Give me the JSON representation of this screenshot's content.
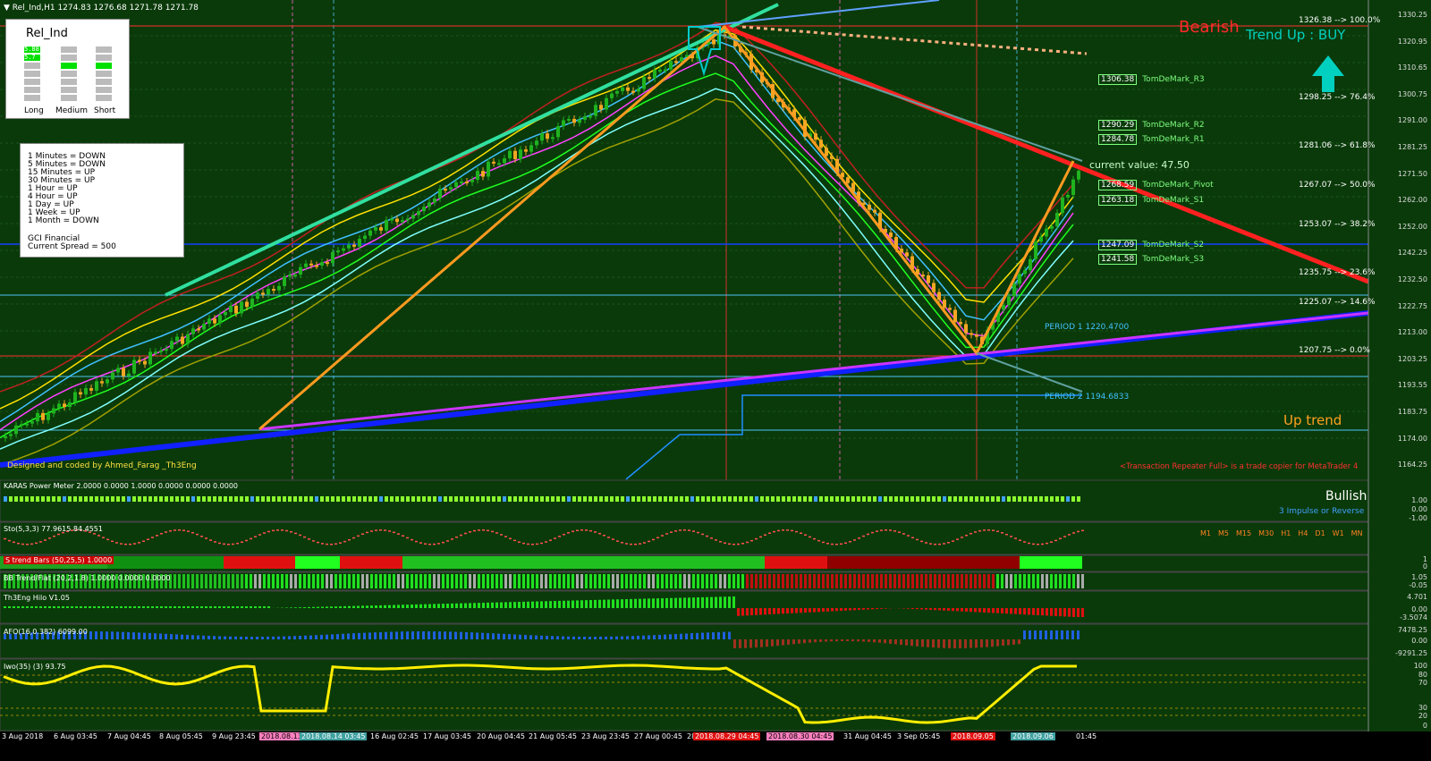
{
  "window": {
    "title": "▼ Rel_Ind,H1  1274.83 1276.68 1271.78 1271.78"
  },
  "rel_ind": {
    "title": "Rel_Ind",
    "values": [
      "5.88",
      "5.7"
    ],
    "columns": [
      "Long",
      "Medium",
      "Short"
    ]
  },
  "timeframes": {
    "lines": [
      "1 Minutes = DOWN",
      "5 Minutes = DOWN",
      "15 Minutes = UP",
      "30 Minutes = UP",
      "1 Hour = UP",
      "4 Hour = UP",
      "1 Day = UP",
      "1 Week = UP",
      "1 Month = DOWN"
    ],
    "broker": "GCI Financial",
    "spread": "Current Spread = 500"
  },
  "credit": "Designed and coded by Ahmed_Farag _Th3Eng",
  "demark": [
    {
      "value": "1306.38",
      "name": "TomDeMark_R3"
    },
    {
      "value": "1290.29",
      "name": "TomDeMark_R2"
    },
    {
      "value": "1284.78",
      "name": "TomDeMark_R1"
    },
    {
      "value": "1268.59",
      "name": "TomDeMark_Pivot"
    },
    {
      "value": "1263.18",
      "name": "TomDeMark_S1"
    },
    {
      "value": "1247.09",
      "name": "TomDeMark_S2"
    },
    {
      "value": "1241.58",
      "name": "TomDeMark_S3"
    }
  ],
  "fibo": [
    {
      "text": "1326.38 --> 100.0%"
    },
    {
      "text": "1298.25 --> 76.4%"
    },
    {
      "text": "1281.06 --> 61.8%"
    },
    {
      "text": "1267.07 --> 50.0%"
    },
    {
      "text": "1253.07 --> 38.2%"
    },
    {
      "text": "1235.75 --> 23.6%"
    },
    {
      "text": "1225.07 --> 14.6%"
    },
    {
      "text": "1207.75 --> 0.0%"
    }
  ],
  "labels": {
    "bearish": "Bearish",
    "trend_up_buy": "Trend Up : BUY",
    "current_value": "current value: 47.50",
    "up_trend": "Up trend",
    "bullish": "Bullish",
    "impulse": "3 Impulse or Reverse",
    "period1": "PERIOD 1",
    "period1_val": "1220.4700",
    "period2": "PERIOD 2",
    "period2_val": "1194.6833",
    "copier": "<Transaction Repeater Full> is a trade copier for MetaTrader 4"
  },
  "price_axis": [
    "1330.25",
    "1320.95",
    "1310.65",
    "1300.75",
    "1291.00",
    "1281.25",
    "1271.50",
    "1262.00",
    "1252.00",
    "1242.25",
    "1232.50",
    "1222.75",
    "1213.00",
    "1203.25",
    "1193.55",
    "1183.75",
    "1174.00",
    "1164.25"
  ],
  "panes": {
    "karas": {
      "title": "KARAS Power Meter 2.0000 0.0000 1.0000 0.0000 0.0000 0.0000",
      "scale": [
        "1.00",
        "0.00",
        "-1.00"
      ]
    },
    "sto": {
      "title": "Sto(5,3,3) 77.9615 84.4551",
      "tfs": [
        "M1",
        "M5",
        "M15",
        "M30",
        "H1",
        "H4",
        "D1",
        "W1",
        "MN"
      ]
    },
    "strend": {
      "title": "S trend Bars (50,25,5) 1.0000",
      "scale": [
        "1",
        "0"
      ]
    },
    "bbtrend": {
      "title": "BB Trend/Flat (20,2,1.8) 1.0000 0.0000 0.0000",
      "scale": [
        "1.05",
        "-0.05"
      ]
    },
    "hilo": {
      "title": "Th3Eng Hilo V1.05",
      "scale": [
        "4.701",
        "0.00",
        "-3.5074"
      ]
    },
    "afo": {
      "title": "AFO(16,0.382) 6099.00",
      "scale": [
        "7478.25",
        "0.00",
        "-9291.25"
      ]
    },
    "iwo": {
      "title": "Iwo(35) (3) 93.75",
      "scale": [
        "100",
        "80",
        "70",
        "30",
        "20",
        "0"
      ]
    }
  },
  "dates": [
    "3 Aug 2018",
    "6 Aug 03:45",
    "7 Aug 04:45",
    "8 Aug 05:45",
    "9 Aug 23:45",
    "2018.08.13",
    "2018.08.14 03:45",
    "16 Aug 02:45",
    "17 Aug 03:45",
    "20 Aug 04:45",
    "21 Aug 05:45",
    "23 Aug 23:45",
    "27 Aug 00:45",
    "28",
    "2018.08.29 04:45",
    "2018.08.30 04:45",
    "31 Aug 04:45",
    "3 Sep 05:45",
    "2018.09.05",
    "2018.09.06",
    "01:45"
  ],
  "colors": {
    "bg": "#0a3a0a",
    "bull": "#1fb31f",
    "bear": "#f5a623",
    "red": "#ff2020",
    "yellow": "#ffff00",
    "blue": "#1020ff"
  }
}
